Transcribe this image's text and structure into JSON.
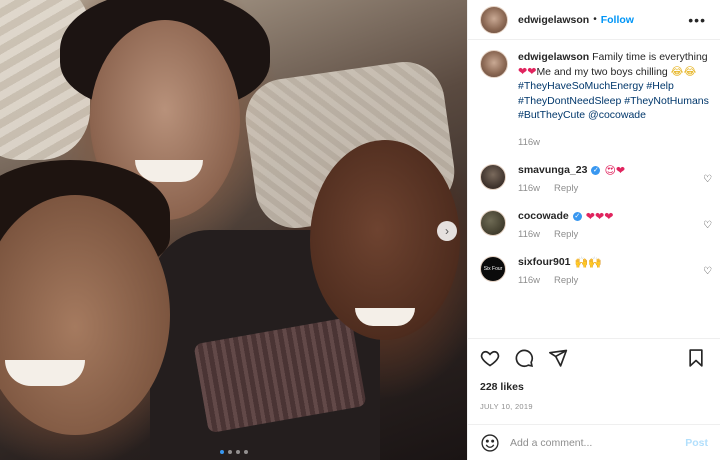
{
  "header": {
    "username": "edwigelawson",
    "separator": "•",
    "follow_label": "Follow",
    "more_icon": "more-horizontal-icon"
  },
  "caption": {
    "username": "edwigelawson",
    "text_1": "Family time is everything",
    "emoji_1": "❤❤",
    "text_2": "Me and my two boys chilling",
    "emoji_2": "😂😂",
    "hashtags": [
      "#TheyHaveSoMuchEnergy",
      "#Help",
      "#TheyDontNeedSleep",
      "#TheyNotHumans",
      "#ButTheyCute"
    ],
    "mention": "@cocowade",
    "time": "116w"
  },
  "comments": [
    {
      "username": "smavunga_23",
      "verified": true,
      "text": "😍❤",
      "time": "116w",
      "reply_label": "Reply"
    },
    {
      "username": "cocowade",
      "verified": true,
      "text": "❤❤❤",
      "time": "116w",
      "reply_label": "Reply"
    },
    {
      "username": "sixfour901",
      "verified": false,
      "text": "🙌🙌",
      "time": "116w",
      "reply_label": "Reply",
      "avatar_text": "Six Four"
    }
  ],
  "likes": "228 likes",
  "date": "JULY 10, 2019",
  "add_comment": {
    "placeholder": "Add a comment...",
    "post_label": "Post"
  },
  "carousel": {
    "slide_count": 4,
    "active_index": 0
  },
  "colors": {
    "link_blue": "#0095f6",
    "hashtag": "#00376b",
    "muted": "#8e8e8e",
    "post_disabled": "#b2dffc"
  }
}
